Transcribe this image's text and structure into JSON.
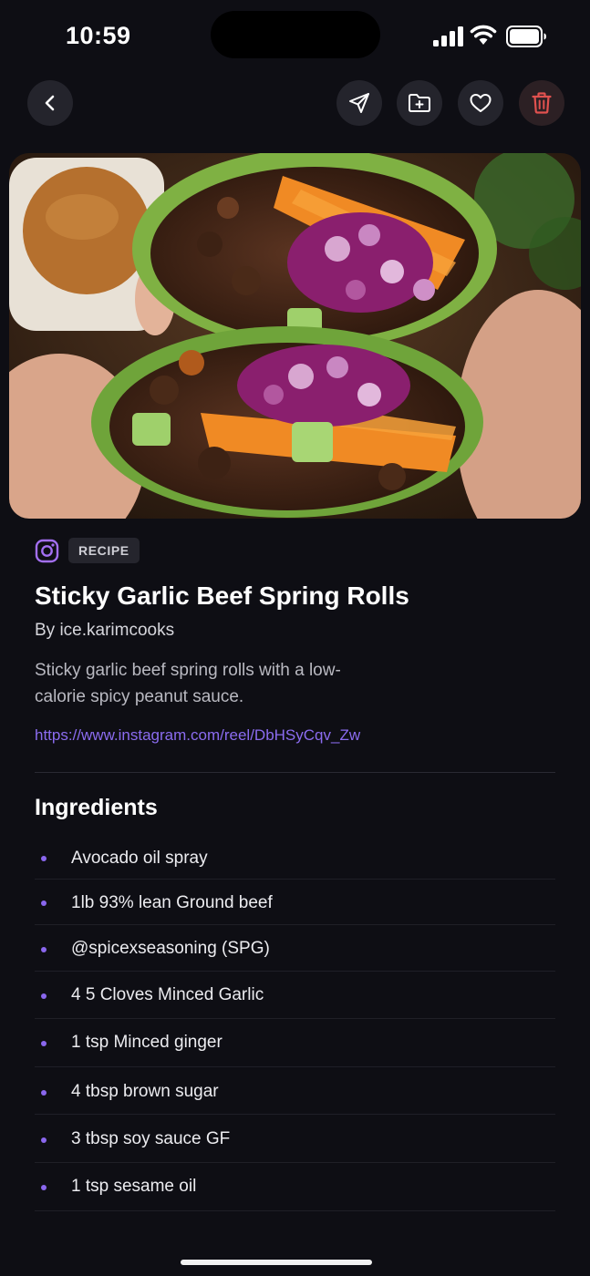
{
  "status_bar": {
    "time": "10:59"
  },
  "toolbar": {
    "back_icon": "chevron-left-icon",
    "share_icon": "send-icon",
    "save_icon": "folder-plus-icon",
    "favorite_icon": "heart-icon",
    "delete_icon": "trash-icon"
  },
  "recipe": {
    "source_icon": "instagram-icon",
    "badge": "RECIPE",
    "title": "Sticky Garlic Beef Spring Rolls",
    "author": "By ice.karimcooks",
    "description": "Sticky garlic beef spring rolls with a low-calorie spicy peanut sauce.",
    "link": "https://www.instagram.com/reel/DbHSyCqv_Zw"
  },
  "ingredients": {
    "heading": "Ingredients",
    "items": [
      "Avocado oil spray",
      "1lb 93% lean Ground beef",
      "@spicexseasoning (SPG)",
      "4 5 Cloves Minced Garlic",
      "1 tsp Minced ginger",
      "4 tbsp brown sugar",
      "3 tbsp soy sauce GF",
      "1 tsp sesame oil"
    ]
  },
  "colors": {
    "background": "#0e0e14",
    "accent": "#8b6cf0",
    "danger": "#e0514f"
  }
}
